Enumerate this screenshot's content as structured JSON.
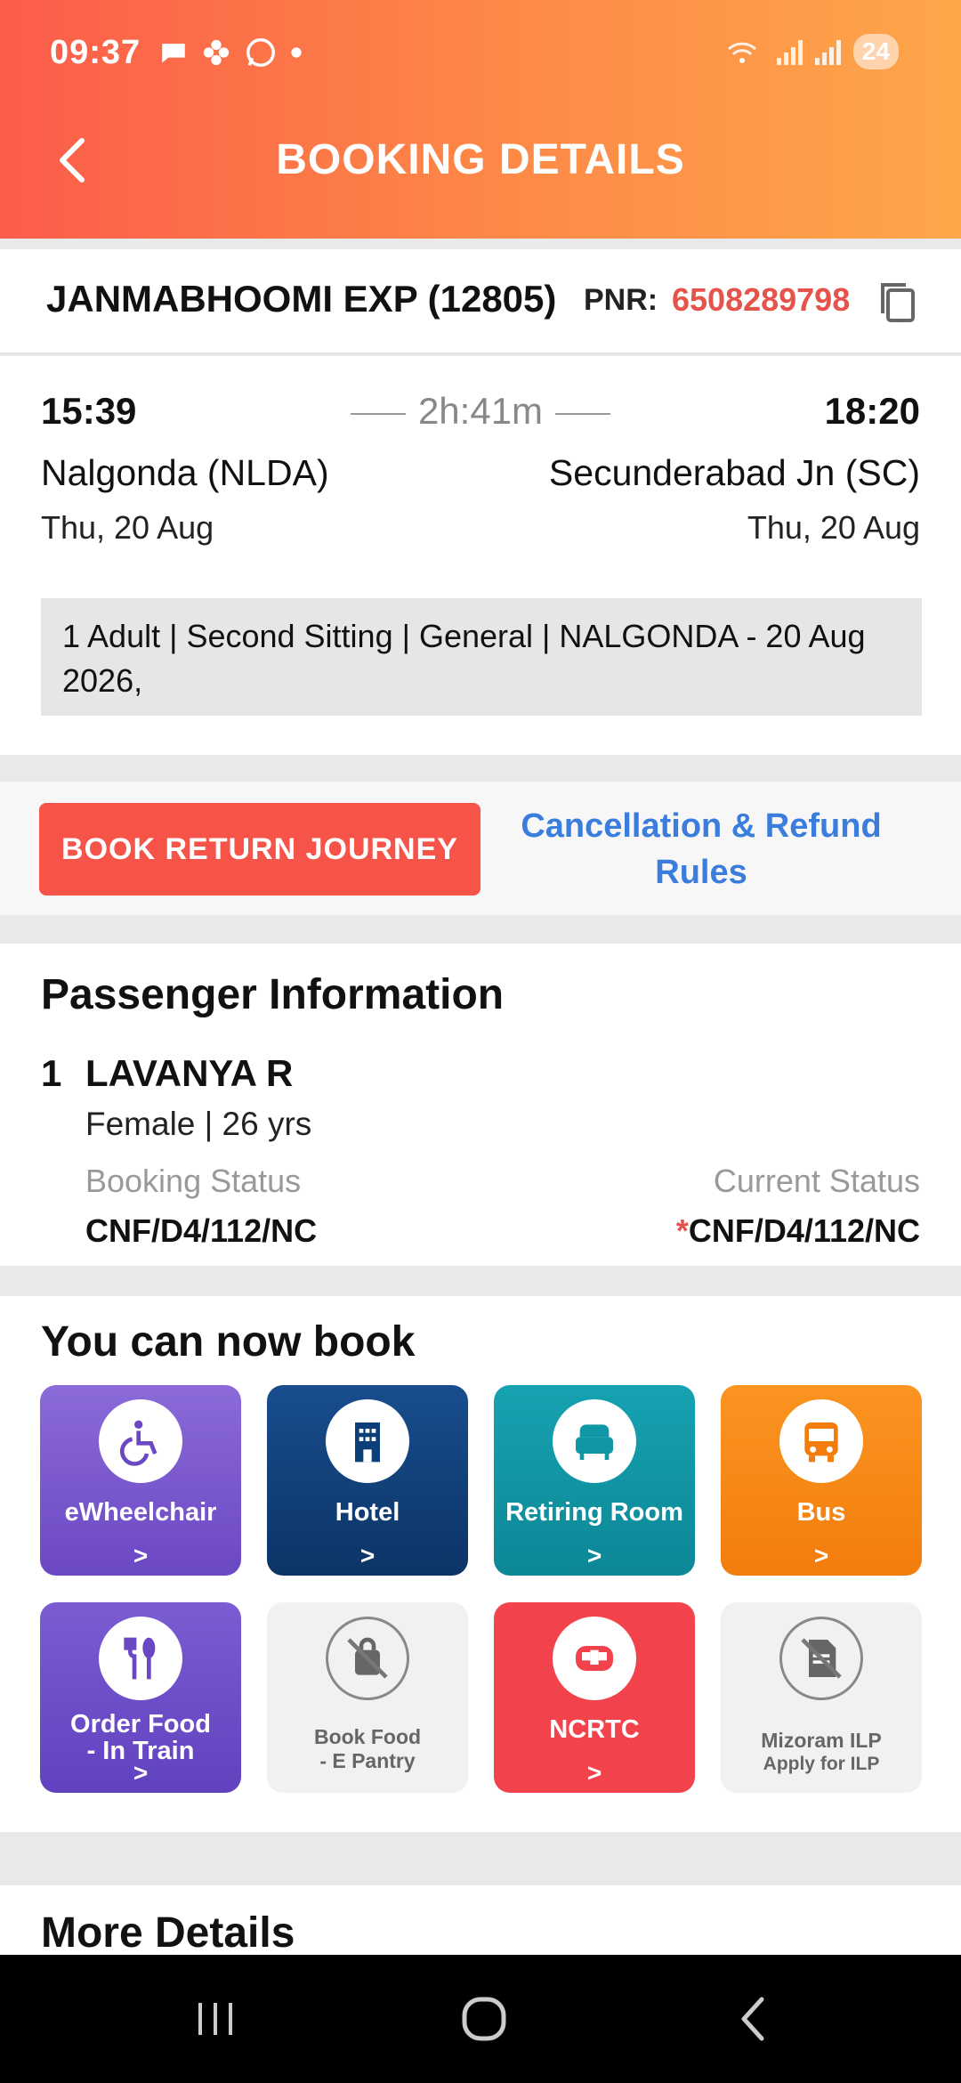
{
  "status_bar": {
    "time": "09:37",
    "battery": "24",
    "left_icons": [
      "chat-bubble-icon",
      "flower-icon",
      "whatsapp-icon",
      "dot-icon"
    ],
    "right_icons": [
      "wifi-5g-icon",
      "signal-icon",
      "signal-icon"
    ]
  },
  "header": {
    "title": "BOOKING DETAILS",
    "back_icon": "chevron-left-icon",
    "colors": {
      "gradient_start": "#fb5c4a",
      "gradient_end": "#fea64a"
    }
  },
  "train": {
    "name": "JANMABHOOMI EXP (12805)",
    "pnr_label": "PNR:",
    "pnr": "6508289798",
    "copy_icon": "copy-icon"
  },
  "journey": {
    "departure_time": "15:39",
    "arrival_time": "18:20",
    "duration": "2h:41m",
    "from_station": "Nalgonda (NLDA)",
    "to_station": "Secunderabad Jn (SC)",
    "departure_date": "Thu, 20 Aug",
    "arrival_date": "Thu, 20 Aug",
    "summary": "1 Adult | Second Sitting | General | NALGONDA - 20 Aug 2026,"
  },
  "actions": {
    "book_return": "BOOK RETURN JOURNEY",
    "cancellation_rules": "Cancellation & Refund Rules",
    "colors": {
      "primary": "#f65349",
      "link": "#3b7ddd"
    }
  },
  "passenger_info": {
    "title": "Passenger Information",
    "passengers": [
      {
        "index": "1",
        "name": "LAVANYA R",
        "details": "Female | 26 yrs",
        "booking_status_label": "Booking Status",
        "current_status_label": "Current Status",
        "booking_status": "CNF/D4/112/NC",
        "current_status_marker": "*",
        "current_status": "CNF/D4/112/NC"
      }
    ]
  },
  "book_now": {
    "title": "You can now book",
    "tiles": [
      {
        "label": "eWheelchair",
        "icon": "wheelchair-icon",
        "color": "#6d4cc9",
        "enabled": true
      },
      {
        "label": "Hotel",
        "icon": "hotel-icon",
        "color": "#0c3e78",
        "enabled": true
      },
      {
        "label": "Retiring Room",
        "icon": "armchair-icon",
        "color": "#0f97a6",
        "enabled": true
      },
      {
        "label": "Bus",
        "icon": "bus-icon",
        "color": "#f88612",
        "enabled": true
      },
      {
        "label": "Order Food - In Train",
        "icon": "fork-spoon-icon",
        "color": "#7050c7",
        "enabled": true
      },
      {
        "label": "Book Food - E Pantry",
        "icon": "food-bag-disabled-icon",
        "color": "#f1f1f1",
        "enabled": false
      },
      {
        "label": "NCRTC",
        "icon": "train-front-icon",
        "color": "#f2424b",
        "enabled": true
      },
      {
        "label": "Mizoram ILP",
        "sublabel": "Apply for ILP",
        "icon": "document-disabled-icon",
        "color": "#f1f1f1",
        "enabled": false
      }
    ],
    "chevron": ">"
  },
  "more_details": {
    "title": "More Details"
  },
  "navbar": {
    "icons": [
      "recent-apps-icon",
      "home-icon",
      "back-icon"
    ]
  }
}
